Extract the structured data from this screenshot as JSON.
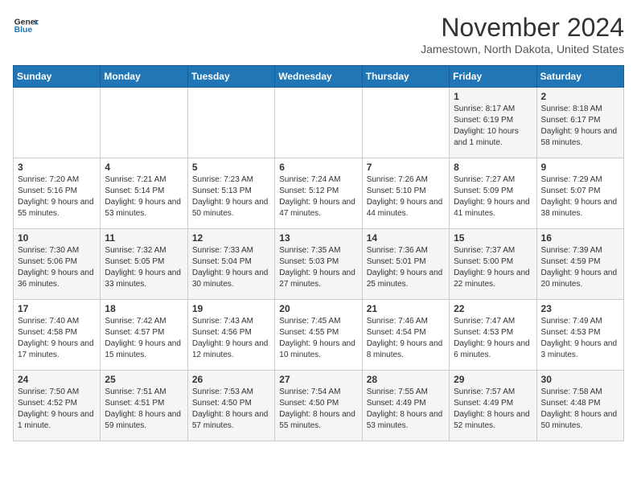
{
  "header": {
    "logo_line1": "General",
    "logo_line2": "Blue",
    "month": "November 2024",
    "location": "Jamestown, North Dakota, United States"
  },
  "days_of_week": [
    "Sunday",
    "Monday",
    "Tuesday",
    "Wednesday",
    "Thursday",
    "Friday",
    "Saturday"
  ],
  "weeks": [
    [
      {
        "day": "",
        "info": ""
      },
      {
        "day": "",
        "info": ""
      },
      {
        "day": "",
        "info": ""
      },
      {
        "day": "",
        "info": ""
      },
      {
        "day": "",
        "info": ""
      },
      {
        "day": "1",
        "info": "Sunrise: 8:17 AM\nSunset: 6:19 PM\nDaylight: 10 hours and 1 minute."
      },
      {
        "day": "2",
        "info": "Sunrise: 8:18 AM\nSunset: 6:17 PM\nDaylight: 9 hours and 58 minutes."
      }
    ],
    [
      {
        "day": "3",
        "info": "Sunrise: 7:20 AM\nSunset: 5:16 PM\nDaylight: 9 hours and 55 minutes."
      },
      {
        "day": "4",
        "info": "Sunrise: 7:21 AM\nSunset: 5:14 PM\nDaylight: 9 hours and 53 minutes."
      },
      {
        "day": "5",
        "info": "Sunrise: 7:23 AM\nSunset: 5:13 PM\nDaylight: 9 hours and 50 minutes."
      },
      {
        "day": "6",
        "info": "Sunrise: 7:24 AM\nSunset: 5:12 PM\nDaylight: 9 hours and 47 minutes."
      },
      {
        "day": "7",
        "info": "Sunrise: 7:26 AM\nSunset: 5:10 PM\nDaylight: 9 hours and 44 minutes."
      },
      {
        "day": "8",
        "info": "Sunrise: 7:27 AM\nSunset: 5:09 PM\nDaylight: 9 hours and 41 minutes."
      },
      {
        "day": "9",
        "info": "Sunrise: 7:29 AM\nSunset: 5:07 PM\nDaylight: 9 hours and 38 minutes."
      }
    ],
    [
      {
        "day": "10",
        "info": "Sunrise: 7:30 AM\nSunset: 5:06 PM\nDaylight: 9 hours and 36 minutes."
      },
      {
        "day": "11",
        "info": "Sunrise: 7:32 AM\nSunset: 5:05 PM\nDaylight: 9 hours and 33 minutes."
      },
      {
        "day": "12",
        "info": "Sunrise: 7:33 AM\nSunset: 5:04 PM\nDaylight: 9 hours and 30 minutes."
      },
      {
        "day": "13",
        "info": "Sunrise: 7:35 AM\nSunset: 5:03 PM\nDaylight: 9 hours and 27 minutes."
      },
      {
        "day": "14",
        "info": "Sunrise: 7:36 AM\nSunset: 5:01 PM\nDaylight: 9 hours and 25 minutes."
      },
      {
        "day": "15",
        "info": "Sunrise: 7:37 AM\nSunset: 5:00 PM\nDaylight: 9 hours and 22 minutes."
      },
      {
        "day": "16",
        "info": "Sunrise: 7:39 AM\nSunset: 4:59 PM\nDaylight: 9 hours and 20 minutes."
      }
    ],
    [
      {
        "day": "17",
        "info": "Sunrise: 7:40 AM\nSunset: 4:58 PM\nDaylight: 9 hours and 17 minutes."
      },
      {
        "day": "18",
        "info": "Sunrise: 7:42 AM\nSunset: 4:57 PM\nDaylight: 9 hours and 15 minutes."
      },
      {
        "day": "19",
        "info": "Sunrise: 7:43 AM\nSunset: 4:56 PM\nDaylight: 9 hours and 12 minutes."
      },
      {
        "day": "20",
        "info": "Sunrise: 7:45 AM\nSunset: 4:55 PM\nDaylight: 9 hours and 10 minutes."
      },
      {
        "day": "21",
        "info": "Sunrise: 7:46 AM\nSunset: 4:54 PM\nDaylight: 9 hours and 8 minutes."
      },
      {
        "day": "22",
        "info": "Sunrise: 7:47 AM\nSunset: 4:53 PM\nDaylight: 9 hours and 6 minutes."
      },
      {
        "day": "23",
        "info": "Sunrise: 7:49 AM\nSunset: 4:53 PM\nDaylight: 9 hours and 3 minutes."
      }
    ],
    [
      {
        "day": "24",
        "info": "Sunrise: 7:50 AM\nSunset: 4:52 PM\nDaylight: 9 hours and 1 minute."
      },
      {
        "day": "25",
        "info": "Sunrise: 7:51 AM\nSunset: 4:51 PM\nDaylight: 8 hours and 59 minutes."
      },
      {
        "day": "26",
        "info": "Sunrise: 7:53 AM\nSunset: 4:50 PM\nDaylight: 8 hours and 57 minutes."
      },
      {
        "day": "27",
        "info": "Sunrise: 7:54 AM\nSunset: 4:50 PM\nDaylight: 8 hours and 55 minutes."
      },
      {
        "day": "28",
        "info": "Sunrise: 7:55 AM\nSunset: 4:49 PM\nDaylight: 8 hours and 53 minutes."
      },
      {
        "day": "29",
        "info": "Sunrise: 7:57 AM\nSunset: 4:49 PM\nDaylight: 8 hours and 52 minutes."
      },
      {
        "day": "30",
        "info": "Sunrise: 7:58 AM\nSunset: 4:48 PM\nDaylight: 8 hours and 50 minutes."
      }
    ]
  ]
}
